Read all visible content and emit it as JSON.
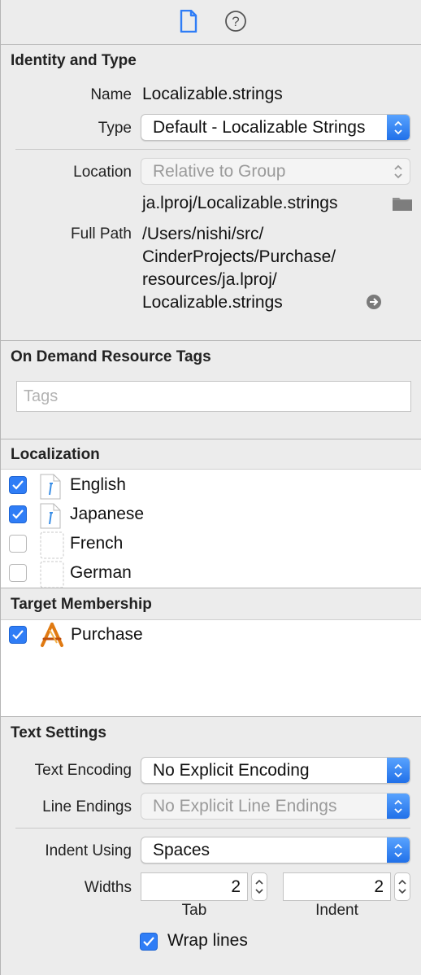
{
  "tabs": {
    "file_icon": "file-inspector-icon",
    "help_icon": "quick-help-icon"
  },
  "identity": {
    "title": "Identity and Type",
    "name_label": "Name",
    "name_value": "Localizable.strings",
    "type_label": "Type",
    "type_value": "Default - Localizable Strings",
    "location_label": "Location",
    "location_value": "Relative to Group",
    "relative_path": "ja.lproj/Localizable.strings",
    "full_path_label": "Full Path",
    "full_path_lines": [
      "/Users/nishi/src/",
      "CinderProjects/Purchase/",
      "resources/ja.lproj/",
      "Localizable.strings"
    ]
  },
  "odr": {
    "title": "On Demand Resource Tags",
    "tags_placeholder": "Tags"
  },
  "localization": {
    "title": "Localization",
    "items": [
      {
        "label": "English",
        "checked": true
      },
      {
        "label": "Japanese",
        "checked": true
      },
      {
        "label": "French",
        "checked": false
      },
      {
        "label": "German",
        "checked": false
      }
    ]
  },
  "target": {
    "title": "Target Membership",
    "items": [
      {
        "label": "Purchase",
        "checked": true
      }
    ]
  },
  "text_settings": {
    "title": "Text Settings",
    "encoding_label": "Text Encoding",
    "encoding_value": "No Explicit Encoding",
    "line_endings_label": "Line Endings",
    "line_endings_value": "No Explicit Line Endings",
    "indent_label": "Indent Using",
    "indent_value": "Spaces",
    "widths_label": "Widths",
    "tab_value": "2",
    "indent_width_value": "2",
    "tab_caption": "Tab",
    "indent_caption": "Indent",
    "wrap_label": "Wrap lines",
    "wrap_checked": true
  },
  "colors": {
    "accent": "#2f7df6",
    "panel_bg": "#ececec"
  }
}
